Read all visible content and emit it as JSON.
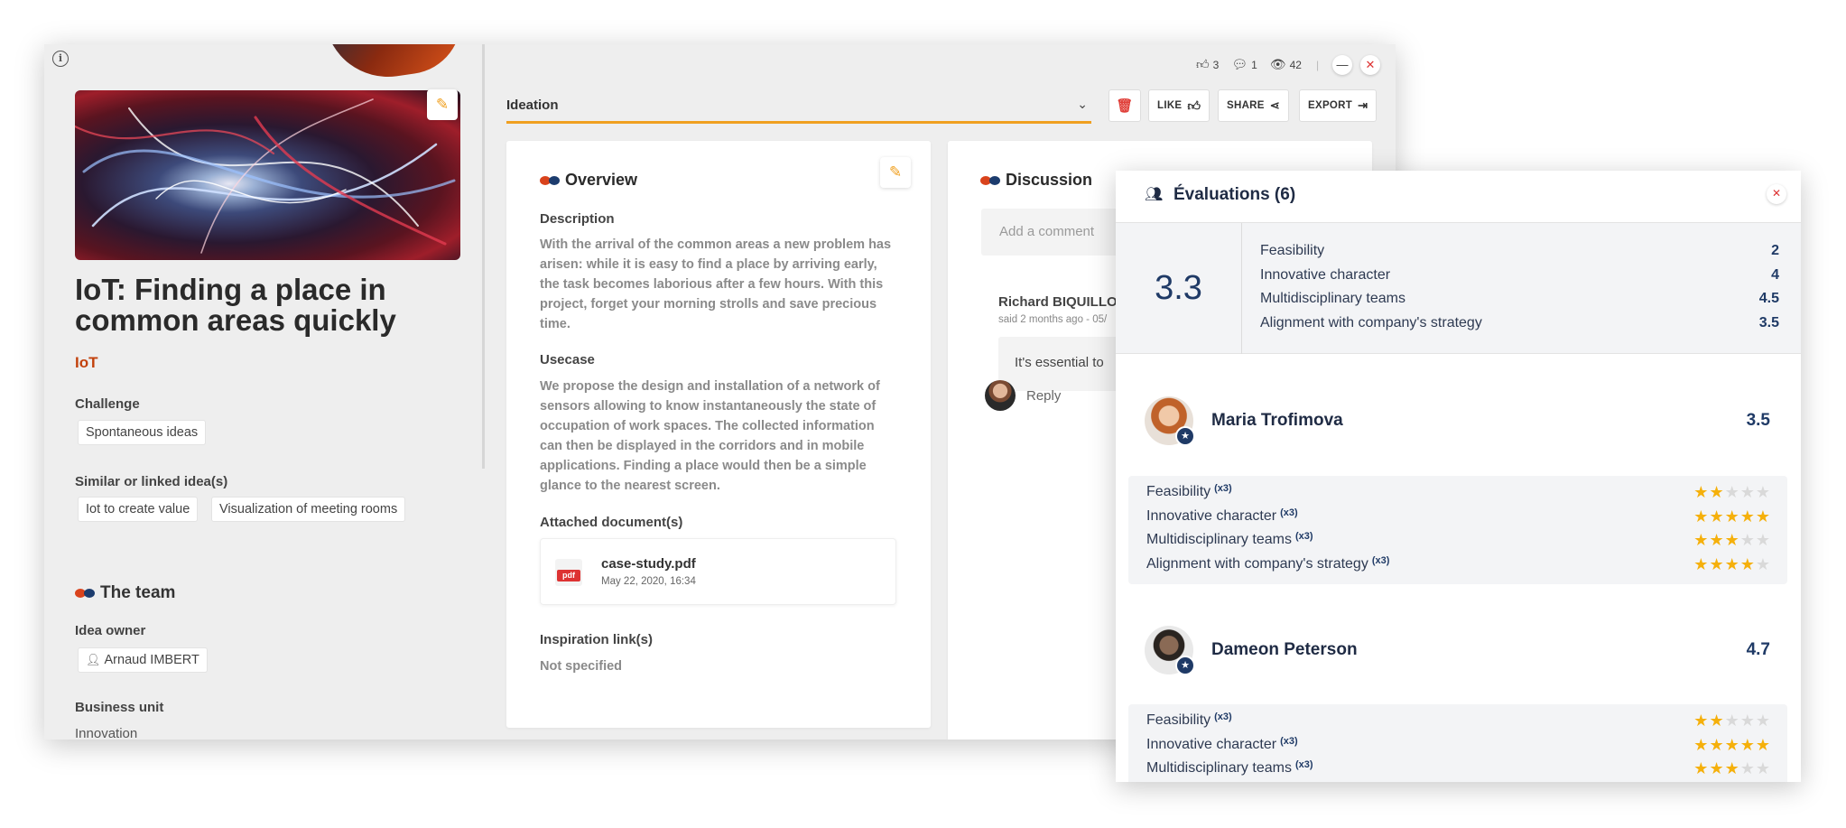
{
  "stats": {
    "likes": "3",
    "comments": "1",
    "views": "42"
  },
  "stage": {
    "label": "Ideation"
  },
  "toolbar": {
    "like_label": "LIKE",
    "share_label": "SHARE",
    "export_label": "EXPORT"
  },
  "idea": {
    "title": "IoT: Finding a place in common areas quickly",
    "tag": "IoT",
    "challenge_label": "Challenge",
    "challenge": "Spontaneous ideas",
    "similar_label": "Similar or linked idea(s)",
    "similar": [
      "Iot to create value",
      "Visualization of meeting rooms"
    ]
  },
  "team": {
    "heading": "The team",
    "owner_label": "Idea owner",
    "owner": "Arnaud IMBERT",
    "bu_label": "Business unit",
    "bu": "Innovation"
  },
  "overview": {
    "heading": "Overview",
    "description_label": "Description",
    "description": "With the arrival of the common areas a new problem has arisen: while it is easy to find a place by arriving early, the task becomes laborious after a few hours. With this project, forget your morning strolls and save precious time.",
    "usecase_label": "Usecase",
    "usecase": "We propose the design and installation of a network of sensors allowing to know instantaneously the state of occupation of work spaces. The collected information can then be displayed in the corridors and in mobile applications. Finding a place would then be a simple glance to the nearest screen.",
    "attached_label": "Attached document(s)",
    "doc_name": "case-study.pdf",
    "doc_date": "May 22, 2020, 16:34",
    "doc_badge": "pdf",
    "inspiration_label": "Inspiration link(s)",
    "inspiration": "Not specified"
  },
  "discussion": {
    "heading": "Discussion",
    "placeholder": "Add a comment",
    "author": "Richard BIQUILLO",
    "meta": "said 2 months ago - 05/",
    "comment": "It's essential to",
    "reply": "Reply"
  },
  "evaluations": {
    "title": "Évaluations (6)",
    "average": "3.3",
    "summary": [
      {
        "label": "Feasibility",
        "value": "2"
      },
      {
        "label": "Innovative character",
        "value": "4"
      },
      {
        "label": "Multidisciplinary teams",
        "value": "4.5"
      },
      {
        "label": "Alignment with company's strategy",
        "value": "3.5"
      }
    ],
    "people": [
      {
        "name": "Maria Trofimova",
        "score": "3.5",
        "criteria": [
          {
            "label": "Feasibility",
            "weight": "(x3)",
            "stars": 2
          },
          {
            "label": "Innovative character",
            "weight": "(x3)",
            "stars": 5
          },
          {
            "label": "Multidisciplinary teams",
            "weight": "(x3)",
            "stars": 3
          },
          {
            "label": "Alignment with company's strategy",
            "weight": "(x3)",
            "stars": 4
          }
        ]
      },
      {
        "name": "Dameon Peterson",
        "score": "4.7",
        "criteria": [
          {
            "label": "Feasibility",
            "weight": "(x3)",
            "stars": 2
          },
          {
            "label": "Innovative character",
            "weight": "(x3)",
            "stars": 5
          },
          {
            "label": "Multidisciplinary teams",
            "weight": "(x3)",
            "stars": 3
          }
        ]
      }
    ]
  },
  "colors": {
    "accent": "#d9431c",
    "navy": "#1f3a66",
    "star": "#f5b00b",
    "stage_underline": "#f0a020"
  }
}
